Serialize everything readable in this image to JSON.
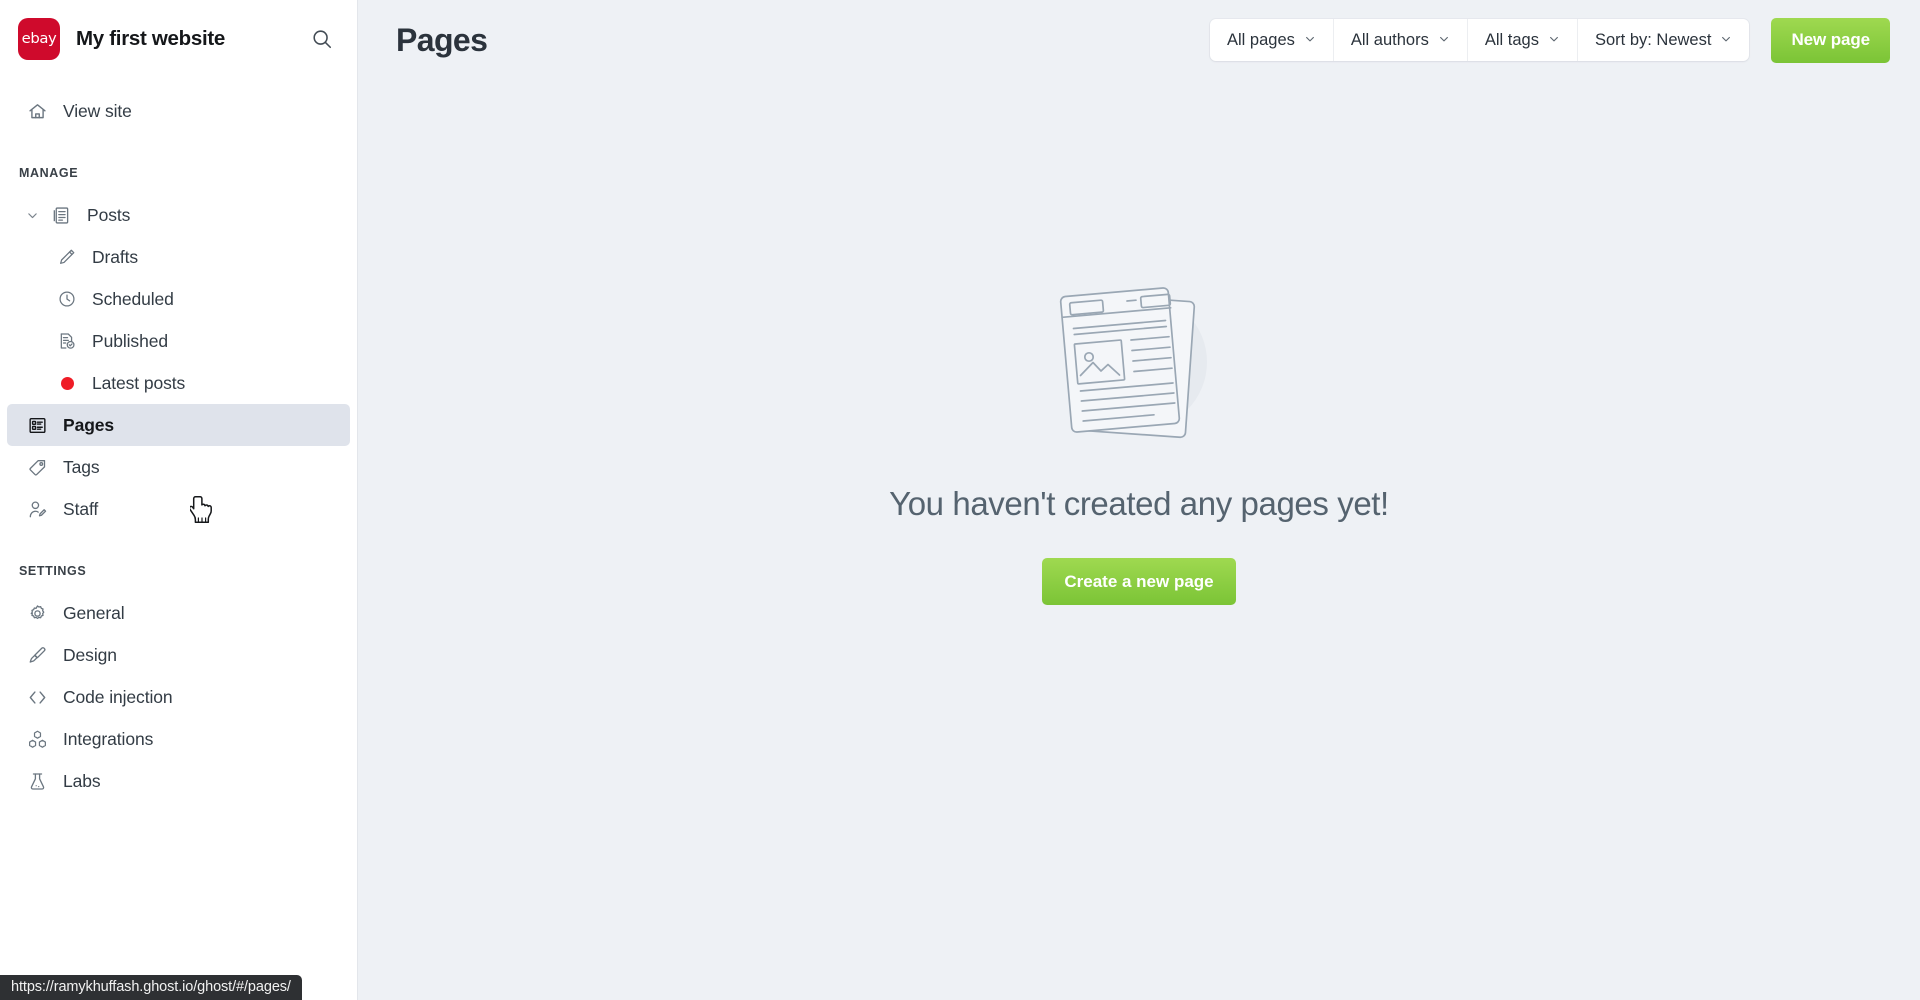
{
  "sidebar": {
    "brand": {
      "logo_text": "ebay",
      "logo_color": "#cf0a2c",
      "title": "My first website",
      "search_icon": "search-icon"
    },
    "view_site": {
      "label": "View site",
      "icon": "home-icon"
    },
    "sections": [
      {
        "title": "MANAGE",
        "items": [
          {
            "label": "Posts",
            "icon": "posts-icon",
            "chevron": "chevron-down-icon",
            "level": "parent",
            "active": false
          },
          {
            "label": "Drafts",
            "icon": "pencil-icon",
            "level": "sub",
            "active": false
          },
          {
            "label": "Scheduled",
            "icon": "clock-icon",
            "level": "sub",
            "active": false
          },
          {
            "label": "Published",
            "icon": "document-check-icon",
            "level": "sub",
            "active": false
          },
          {
            "label": "Latest posts",
            "icon": "red-dot-icon",
            "level": "sub",
            "active": false
          },
          {
            "label": "Pages",
            "icon": "pages-icon",
            "level": "top",
            "active": true
          },
          {
            "label": "Tags",
            "icon": "tag-icon",
            "level": "top",
            "active": false
          },
          {
            "label": "Staff",
            "icon": "person-edit-icon",
            "level": "top",
            "active": false
          }
        ]
      },
      {
        "title": "SETTINGS",
        "items": [
          {
            "label": "General",
            "icon": "gear-icon",
            "level": "top",
            "active": false
          },
          {
            "label": "Design",
            "icon": "paintbrush-icon",
            "level": "top",
            "active": false
          },
          {
            "label": "Code injection",
            "icon": "code-brackets-icon",
            "level": "top",
            "active": false
          },
          {
            "label": "Integrations",
            "icon": "cubes-icon",
            "level": "top",
            "active": false
          },
          {
            "label": "Labs",
            "icon": "flask-icon",
            "level": "top",
            "active": false
          }
        ]
      }
    ]
  },
  "header": {
    "title": "Pages",
    "filters": [
      {
        "label": "All pages",
        "icon": "chevron-down-icon"
      },
      {
        "label": "All authors",
        "icon": "chevron-down-icon"
      },
      {
        "label": "All tags",
        "icon": "chevron-down-icon"
      },
      {
        "label": "Sort by: Newest",
        "icon": "chevron-down-icon"
      }
    ],
    "new_page_label": "New page"
  },
  "empty_state": {
    "graphic": "page-list-illustration",
    "title": "You haven't created any pages yet!",
    "button_label": "Create a new page"
  },
  "status_bar": {
    "url": "https://ramykhuffash.ghost.io/ghost/#/pages/"
  },
  "colors": {
    "accent_green": "#7bc436",
    "brand_red": "#cf0a2c",
    "main_bg": "#eef1f5",
    "sidebar_bg": "#ffffff",
    "active_item_bg": "#dfe3eb",
    "text_dark": "#15171a",
    "text_muted": "#55636f"
  }
}
